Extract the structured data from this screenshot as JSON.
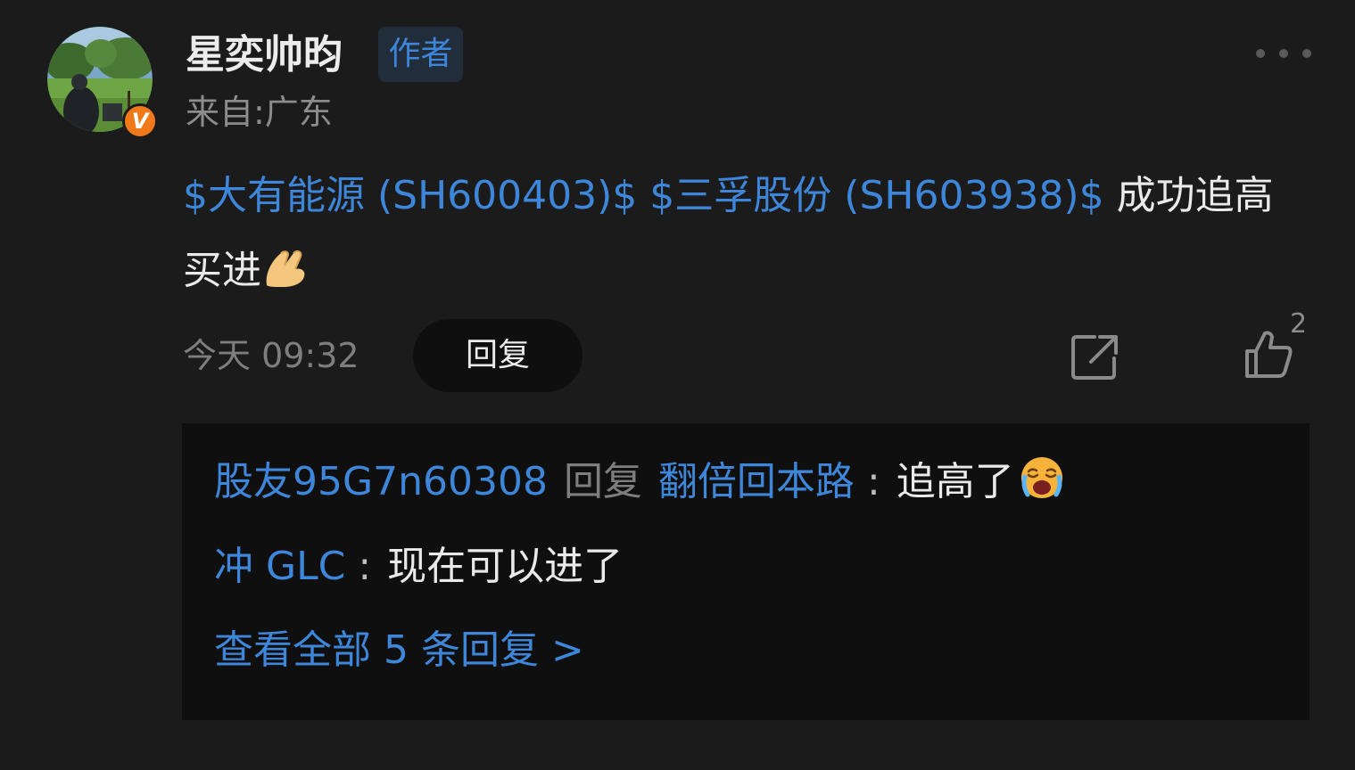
{
  "comment": {
    "username": "星奕帅昀",
    "author_tag": "作者",
    "location": "来自:广东",
    "verified_badge": "V",
    "body": {
      "stock1": "$大有能源 (SH600403)$",
      "stock2": "$三孚股份 (SH603938)$",
      "text": "成功追高买进",
      "emoji": "pinched-fingers-emoji"
    },
    "timestamp": "今天 09:32",
    "reply_label": "回复",
    "like_count": "2"
  },
  "replies": [
    {
      "author": "股友95G7n60308",
      "reply_word": "回复",
      "target": "翻倍回本路",
      "colon": ":",
      "text": "追高了",
      "emoji": "crying-face-emoji"
    },
    {
      "author": "冲 GLC",
      "colon": ":",
      "text": "现在可以进了"
    }
  ],
  "view_all": "查看全部 5 条回复 >",
  "icons": {
    "more": "more-icon",
    "share": "share-icon",
    "like": "thumbs-up-icon"
  },
  "colors": {
    "background": "#1b1b1b",
    "link": "#3d86d9",
    "badge": "#f07a1a",
    "reply_panel": "#0f0f0f"
  }
}
